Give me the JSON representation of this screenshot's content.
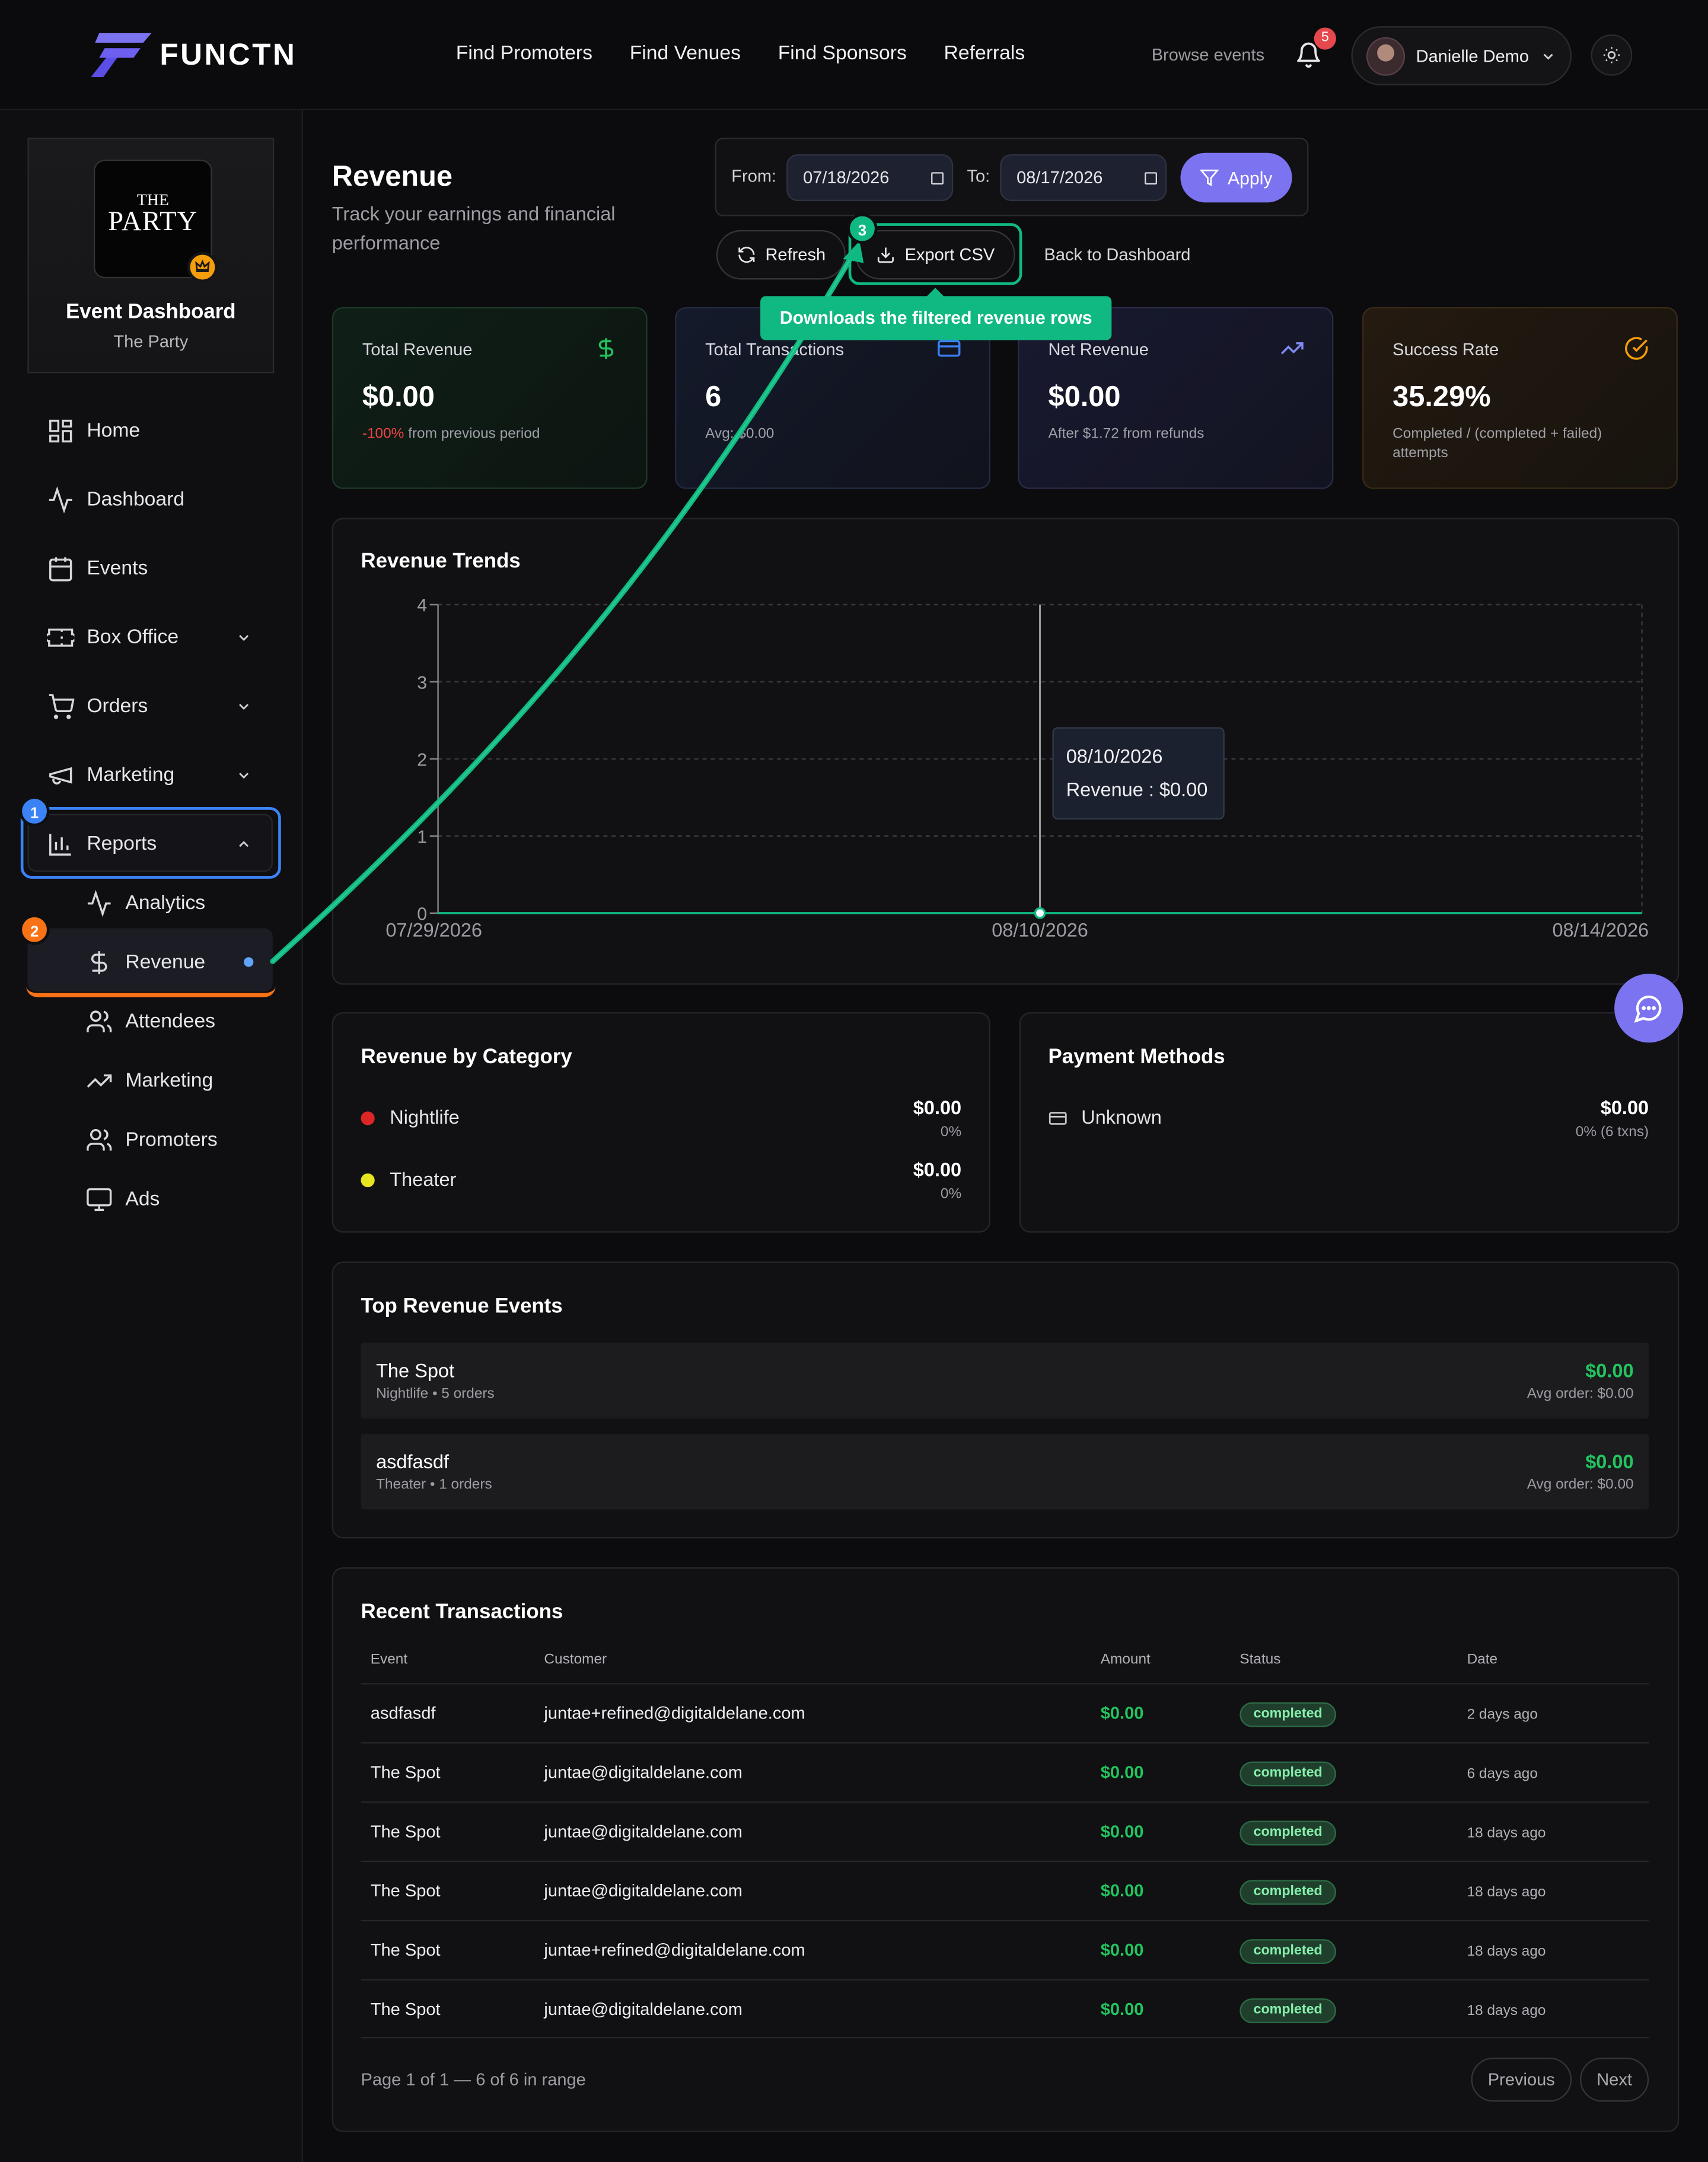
{
  "brand": {
    "name": "FUNCTN",
    "accent": "#7c73f0"
  },
  "nav": {
    "links": [
      "Find Promoters",
      "Find Venues",
      "Find Sponsors",
      "Referrals"
    ],
    "browse": "Browse events",
    "notifications": "5",
    "user": "Danielle Demo"
  },
  "sidebar": {
    "event_title": "Event Dashboard",
    "event_sub": "The Party",
    "poster_line1": "THE",
    "poster_line2": "PARTY",
    "items": [
      "Home",
      "Dashboard",
      "Events",
      "Box Office",
      "Orders",
      "Marketing",
      "Reports"
    ],
    "subitems": [
      "Analytics",
      "Revenue",
      "Attendees",
      "Marketing",
      "Promoters",
      "Ads"
    ],
    "badge1": "1",
    "badge2": "2"
  },
  "header": {
    "title": "Revenue",
    "subtitle": "Track your earnings and financial performance",
    "from_label": "From:",
    "from_value": "07/18/2026",
    "to_label": "To:",
    "to_value": "08/17/2026",
    "apply": "Apply",
    "refresh": "Refresh",
    "export": "Export CSV",
    "back": "Back to Dashboard",
    "badge3": "3",
    "tooltip": "Downloads the filtered revenue rows"
  },
  "stats": [
    {
      "label": "Total Revenue",
      "value": "$0.00",
      "note_change": "-100%",
      "note": "from previous period"
    },
    {
      "label": "Total Transactions",
      "value": "6",
      "note": "Avg: $0.00"
    },
    {
      "label": "Net Revenue",
      "value": "$0.00",
      "note": "After $1.72 from refunds"
    },
    {
      "label": "Success Rate",
      "value": "35.29%",
      "note": "Completed / (completed + failed) attempts"
    }
  ],
  "chart_data": {
    "type": "line",
    "title": "Revenue Trends",
    "x": [
      "07/29/2026",
      "08/10/2026",
      "08/14/2026"
    ],
    "series": [
      {
        "name": "Revenue",
        "values": [
          0,
          0,
          0
        ]
      }
    ],
    "y_ticks": [
      "0",
      "1",
      "2",
      "3",
      "4"
    ],
    "ylim": [
      0,
      4
    ],
    "tooltip_date": "08/10/2026",
    "tooltip_text": "Revenue : $0.00",
    "grid": true,
    "line_color": "#10b981"
  },
  "category": {
    "title": "Revenue by Category",
    "rows": [
      {
        "name": "Nightlife",
        "value": "$0.00",
        "pct": "0%",
        "color": "#dc2626"
      },
      {
        "name": "Theater",
        "value": "$0.00",
        "pct": "0%",
        "color": "#e5e520"
      }
    ]
  },
  "payments": {
    "title": "Payment Methods",
    "rows": [
      {
        "name": "Unknown",
        "value": "$0.00",
        "pct": "0% (6 txns)"
      }
    ]
  },
  "top_events": {
    "title": "Top Revenue Events",
    "rows": [
      {
        "name": "The Spot",
        "meta": "Nightlife • 5 orders",
        "amount": "$0.00",
        "avg": "Avg order: $0.00"
      },
      {
        "name": "asdfasdf",
        "meta": "Theater • 1 orders",
        "amount": "$0.00",
        "avg": "Avg order: $0.00"
      }
    ]
  },
  "transactions": {
    "title": "Recent Transactions",
    "columns": [
      "Event",
      "Customer",
      "Amount",
      "Status",
      "Date"
    ],
    "rows": [
      [
        "asdfasdf",
        "juntae+refined@digitaldelane.com",
        "$0.00",
        "completed",
        "2 days ago"
      ],
      [
        "The Spot",
        "juntae@digitaldelane.com",
        "$0.00",
        "completed",
        "6 days ago"
      ],
      [
        "The Spot",
        "juntae@digitaldelane.com",
        "$0.00",
        "completed",
        "18 days ago"
      ],
      [
        "The Spot",
        "juntae@digitaldelane.com",
        "$0.00",
        "completed",
        "18 days ago"
      ],
      [
        "The Spot",
        "juntae+refined@digitaldelane.com",
        "$0.00",
        "completed",
        "18 days ago"
      ],
      [
        "The Spot",
        "juntae@digitaldelane.com",
        "$0.00",
        "completed",
        "18 days ago"
      ]
    ],
    "pager": "Page 1 of 1 — 6 of 6 in range",
    "prev": "Previous",
    "next": "Next"
  }
}
